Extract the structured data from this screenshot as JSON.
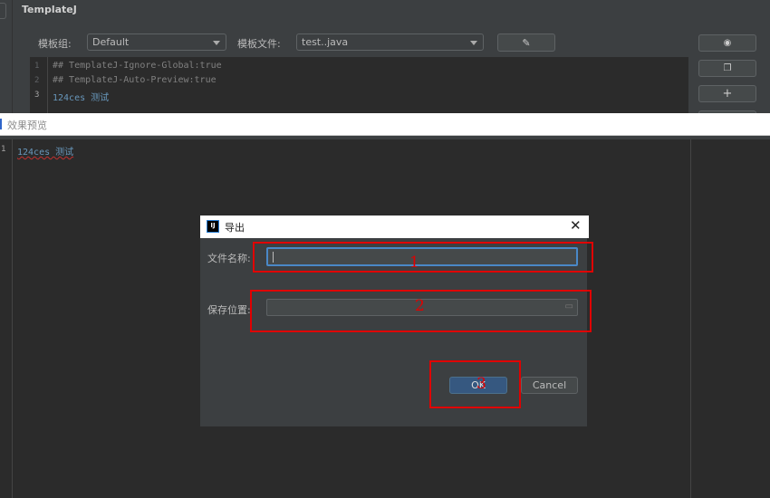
{
  "panel": {
    "title": "TemplateJ",
    "group_label": "模板组:",
    "group_value": "Default",
    "file_label": "模板文件:",
    "file_value": "test..java"
  },
  "editor": {
    "lines": [
      {
        "n": "1",
        "text": "## TemplateJ-Ignore-Global:true"
      },
      {
        "n": "2",
        "text": "## TemplateJ-Auto-Preview:true"
      },
      {
        "n": "3",
        "text": "124ces 测试"
      }
    ]
  },
  "side_buttons": [
    "eye-icon",
    "copy-icon",
    "plus-icon"
  ],
  "preview": {
    "label": "效果预览",
    "lines": [
      {
        "n": "1",
        "text": "124ces 测试"
      }
    ]
  },
  "dialog": {
    "title": "导出",
    "filename_label": "文件名称:",
    "filename_value": "",
    "location_label": "保存位置:",
    "location_value": "",
    "ok": "OK",
    "cancel": "Cancel"
  },
  "annotations": [
    "1",
    "2",
    "3"
  ],
  "colors": {
    "annotation": "#e00000",
    "ok_button": "#365880",
    "focus_border": "#4a88c7"
  }
}
